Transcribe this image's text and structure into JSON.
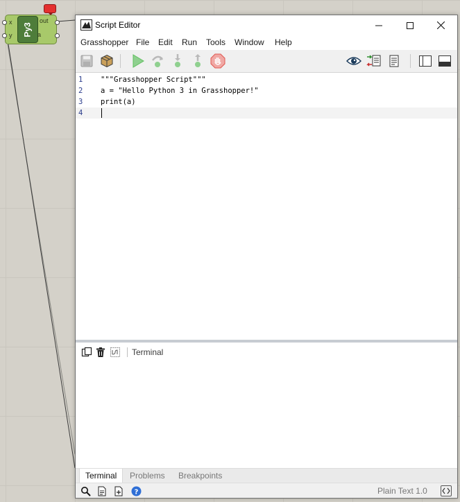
{
  "component": {
    "name": "Py3",
    "inputs": [
      "x",
      "y"
    ],
    "outputs": [
      "out",
      "a"
    ]
  },
  "window": {
    "title": "Script Editor"
  },
  "menu": [
    "Grasshopper",
    "File",
    "Edit",
    "Run",
    "Tools",
    "Window",
    "Help"
  ],
  "toolbar": {
    "icons": [
      "save-icon",
      "package-icon",
      "run-icon",
      "step-over-icon",
      "step-into-icon",
      "step-out-icon",
      "stop-icon",
      "eye-icon",
      "import-export-icon",
      "script-info-icon",
      "layout-side-icon",
      "layout-bottom-icon"
    ]
  },
  "editor": {
    "lines": [
      {
        "num": "1",
        "text": "\"\"\"Grasshopper Script\"\"\""
      },
      {
        "num": "2",
        "text": "a = \"Hello Python 3 in Grasshopper!\""
      },
      {
        "num": "3",
        "text": "print(a)"
      },
      {
        "num": "4",
        "text": ""
      }
    ]
  },
  "panel": {
    "label": "Terminal"
  },
  "tabs": [
    "Terminal",
    "Problems",
    "Breakpoints"
  ],
  "status": {
    "language": "Plain Text 1.0"
  },
  "colors": {
    "line_number": "#2b3d8c",
    "run_green": "#5fbf5f",
    "stop_red": "#e0574f",
    "component_green": "#a8c96a"
  }
}
